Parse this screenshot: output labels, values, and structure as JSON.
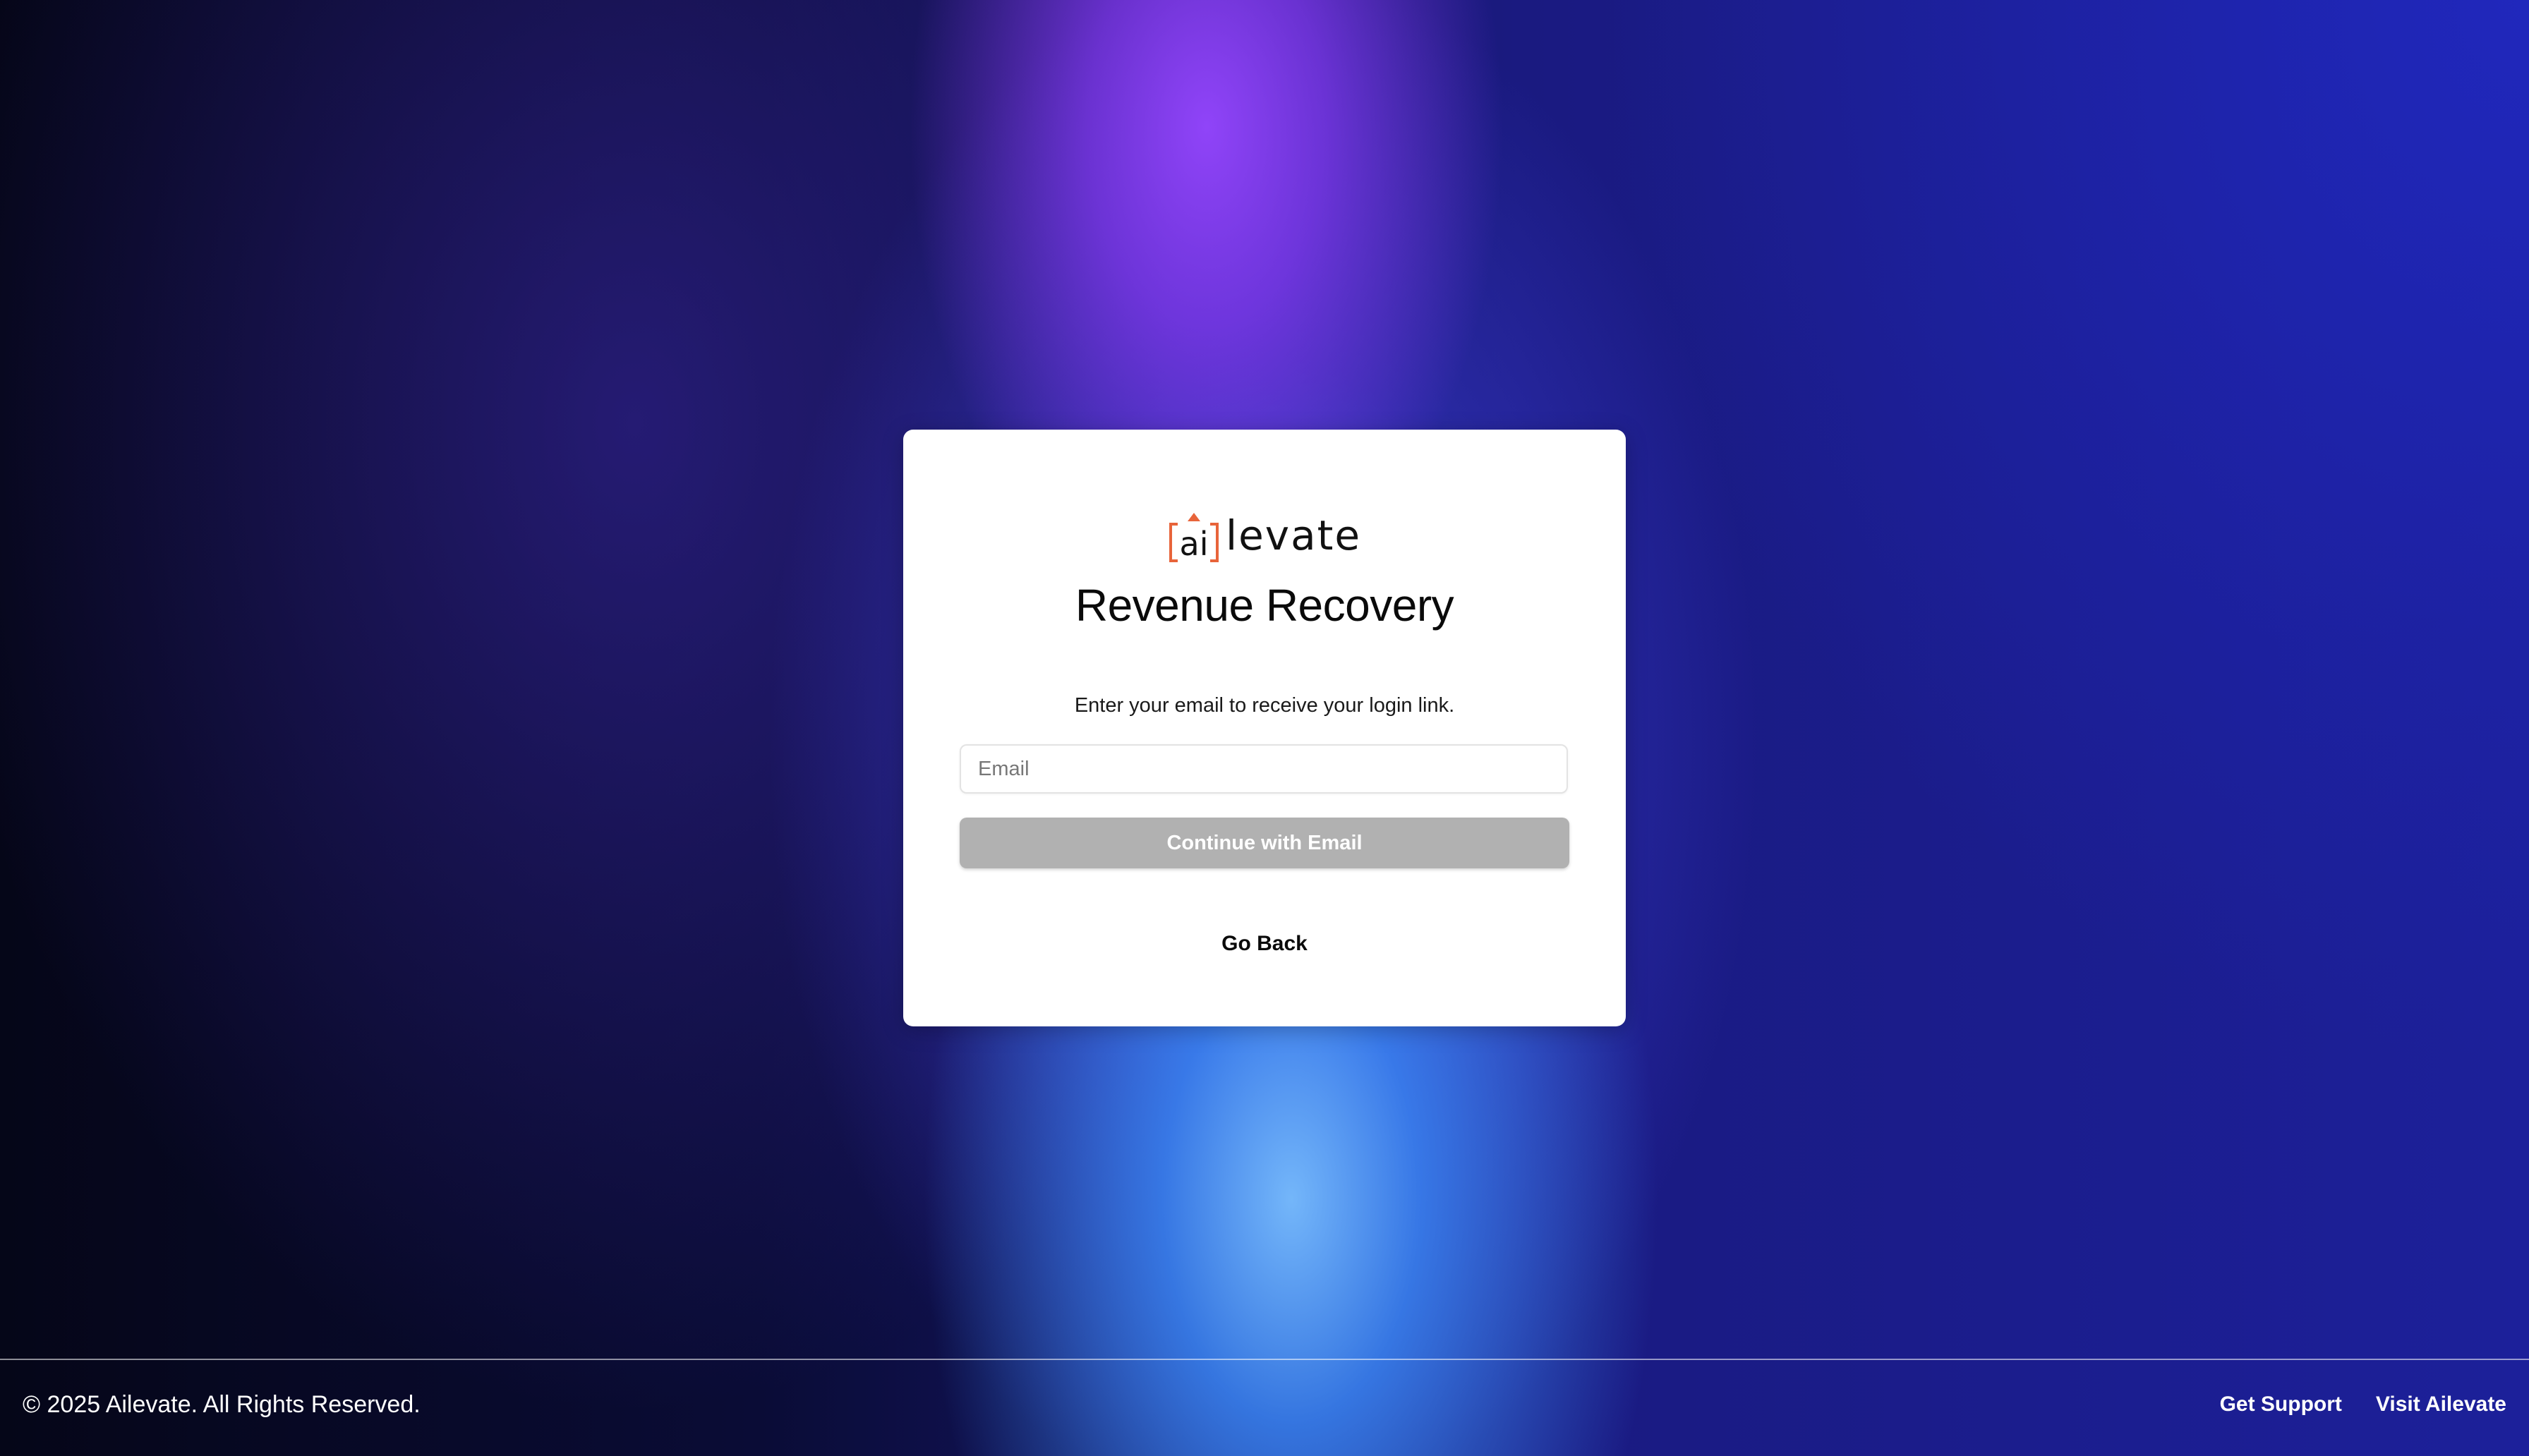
{
  "brand": {
    "logo_mark_text": "ai",
    "logo_word": "levate",
    "logo_accent_color": "#e8643a"
  },
  "card": {
    "title": "Revenue Recovery",
    "subtitle": "Enter your email to receive your login link.",
    "email_placeholder": "Email",
    "email_value": "",
    "continue_label": "Continue with Email",
    "go_back_label": "Go Back"
  },
  "footer": {
    "copyright": "© 2025 Ailevate. All Rights Reserved.",
    "links": [
      {
        "label": "Get Support"
      },
      {
        "label": "Visit Ailevate"
      }
    ]
  },
  "colors": {
    "button_disabled_bg": "#b1b1b1",
    "card_bg": "#ffffff"
  }
}
